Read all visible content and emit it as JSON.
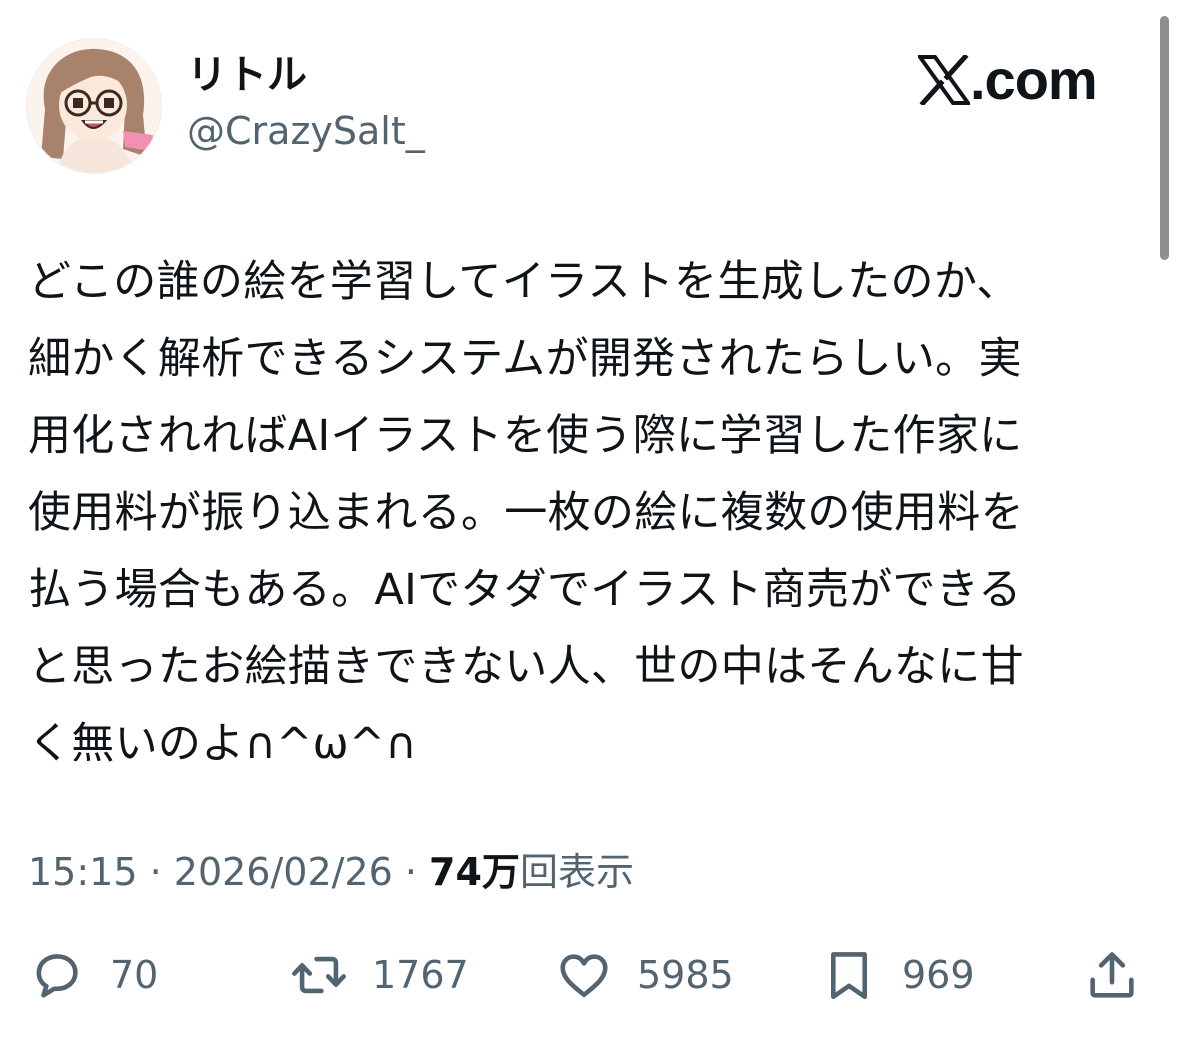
{
  "brand": {
    "logo_text": ".com"
  },
  "author": {
    "display_name": "リトル",
    "handle": "@CrazySalt_"
  },
  "tweet": {
    "lines": [
      "どこの誰の絵を学習してイラストを生成したのか、",
      "細かく解析できるシステムが開発されたらしい。実",
      "用化されればAIイラストを使う際に学習した作家に",
      "使用料が振り込まれる。一枚の絵に複数の使用料を",
      "払う場合もある。AIでタダでイラスト商売ができる",
      "と思ったお絵描きできない人、世の中はそんなに甘",
      "く無いのよ∩^ω^∩"
    ]
  },
  "meta": {
    "time": "15:15",
    "separator": " · ",
    "date": "2026/02/26",
    "views_count": "74万",
    "views_label": "回表示"
  },
  "actions": {
    "replies": {
      "icon": "reply-icon",
      "count": "70"
    },
    "reposts": {
      "icon": "repost-icon",
      "count": "1767"
    },
    "likes": {
      "icon": "heart-icon",
      "count": "5985"
    },
    "bookmarks": {
      "icon": "bookmark-icon",
      "count": "969"
    },
    "share": {
      "icon": "share-icon"
    }
  },
  "colors": {
    "text_primary": "#0f1419",
    "text_secondary": "#536471",
    "background": "#ffffff"
  }
}
